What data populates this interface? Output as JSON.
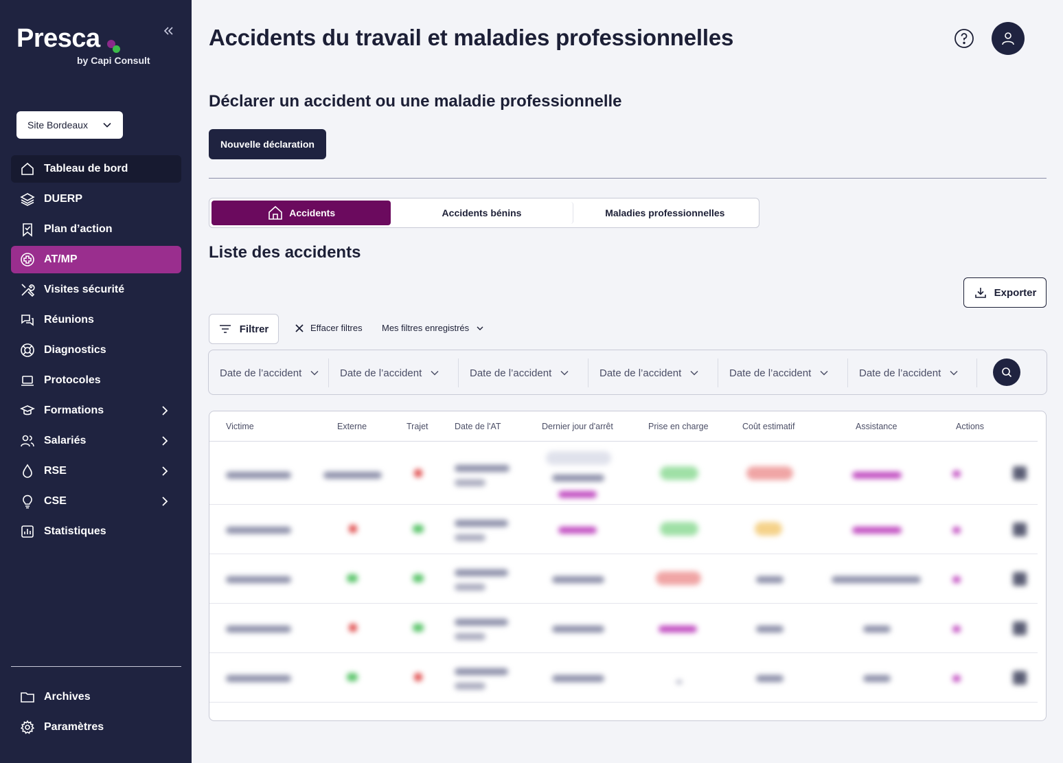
{
  "sidebar": {
    "logo": "Presca",
    "logo_sub": "by Capi Consult",
    "site": "Site Bordeaux",
    "items": [
      {
        "label": "Tableau de bord"
      },
      {
        "label": "DUERP"
      },
      {
        "label": "Plan d’action"
      },
      {
        "label": "AT/MP"
      },
      {
        "label": "Visites sécurité"
      },
      {
        "label": "Réunions"
      },
      {
        "label": "Diagnostics"
      },
      {
        "label": "Protocoles"
      },
      {
        "label": "Formations"
      },
      {
        "label": "Salariés"
      },
      {
        "label": "RSE"
      },
      {
        "label": "CSE"
      },
      {
        "label": "Statistiques"
      }
    ],
    "bottom": [
      {
        "label": "Archives"
      },
      {
        "label": "Paramètres"
      }
    ]
  },
  "header": {
    "title": "Accidents du travail et maladies professionnelles"
  },
  "declare": {
    "title": "Déclarer un accident ou une maladie professionnelle",
    "button": "Nouvelle déclaration"
  },
  "tabs": [
    {
      "label": "Accidents"
    },
    {
      "label": "Accidents bénins"
    },
    {
      "label": "Maladies professionnelles"
    }
  ],
  "list": {
    "title": "Liste des accidents",
    "export": "Exporter",
    "filter": "Filtrer",
    "clear_filters": "Effacer filtres",
    "saved_filters": "Mes filtres enregistrés",
    "date_filters": [
      "Date de l’accident",
      "Date de l’accident",
      "Date de l’accident",
      "Date de l’accident",
      "Date de l’accident",
      "Date de l’accident"
    ]
  },
  "table": {
    "columns": [
      "Victime",
      "Externe",
      "Trajet",
      "Date de l'AT",
      "Dernier jour d'arrêt",
      "Prise en charge",
      "Coût estimatif",
      "Assistance",
      "Actions"
    ]
  },
  "colors": {
    "sidebar_bg": "#1f2340",
    "accent": "#9a2e8e",
    "tab_active": "#6b0a5e"
  }
}
